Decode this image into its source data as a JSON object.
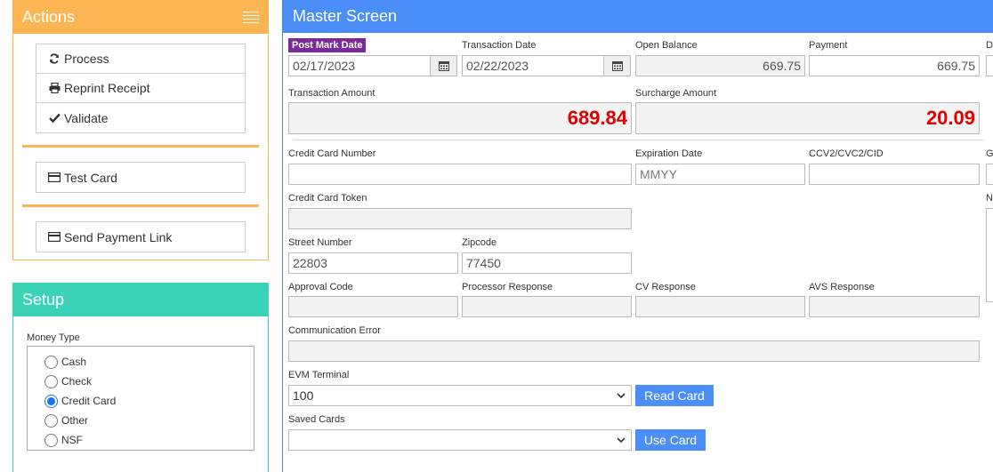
{
  "actions": {
    "title": "Actions",
    "buttons": [
      {
        "label": "Process",
        "icon": "refresh-icon"
      },
      {
        "label": "Reprint Receipt",
        "icon": "printer-icon"
      },
      {
        "label": "Validate",
        "icon": "checkmark-icon"
      }
    ],
    "test_card": {
      "label": "Test Card",
      "icon": "credit-card-icon"
    },
    "send_link": {
      "label": "Send Payment Link",
      "icon": "credit-card-icon"
    },
    "accent": "#fbb552"
  },
  "setup": {
    "title": "Setup",
    "money_type_label": "Money Type",
    "options": [
      {
        "label": "Cash",
        "checked": false
      },
      {
        "label": "Check",
        "checked": false
      },
      {
        "label": "Credit Card",
        "checked": true
      },
      {
        "label": "Other",
        "checked": false
      },
      {
        "label": "NSF",
        "checked": false
      }
    ],
    "accent": "#3ad3b7"
  },
  "master": {
    "title": "Master Screen",
    "accent": "#4c8ef7",
    "post_mark_date": {
      "label": "Post Mark Date",
      "value": "02/17/2023"
    },
    "transaction_date": {
      "label": "Transaction Date",
      "value": "02/22/2023"
    },
    "open_balance": {
      "label": "Open Balance",
      "value": "669.75"
    },
    "payment": {
      "label": "Payment",
      "value": "669.75"
    },
    "cut_label_1": "D",
    "transaction_amount": {
      "label": "Transaction Amount",
      "value": "689.84"
    },
    "surcharge_amount": {
      "label": "Surcharge Amount",
      "value": "20.09"
    },
    "credit_card_number": {
      "label": "Credit Card Number",
      "value": ""
    },
    "expiration_date": {
      "label": "Expiration Date",
      "placeholder": "MMYY"
    },
    "ccv": {
      "label": "CCV2/CVC2/CID",
      "value": ""
    },
    "cut_label_2": "G",
    "credit_card_token": {
      "label": "Credit Card Token",
      "value": ""
    },
    "cut_label_3": "N",
    "street_number": {
      "label": "Street Number",
      "value": "22803"
    },
    "zipcode": {
      "label": "Zipcode",
      "value": "77450"
    },
    "approval_code": {
      "label": "Approval Code",
      "value": ""
    },
    "processor_response": {
      "label": "Processor Response",
      "value": ""
    },
    "cv_response": {
      "label": "CV Response",
      "value": ""
    },
    "avs_response": {
      "label": "AVS Response",
      "value": ""
    },
    "communication_error": {
      "label": "Communication Error",
      "value": ""
    },
    "evm_terminal": {
      "label": "EVM Terminal",
      "value": "100"
    },
    "read_card": "Read Card",
    "saved_cards": {
      "label": "Saved Cards",
      "value": ""
    },
    "use_card": "Use Card"
  }
}
